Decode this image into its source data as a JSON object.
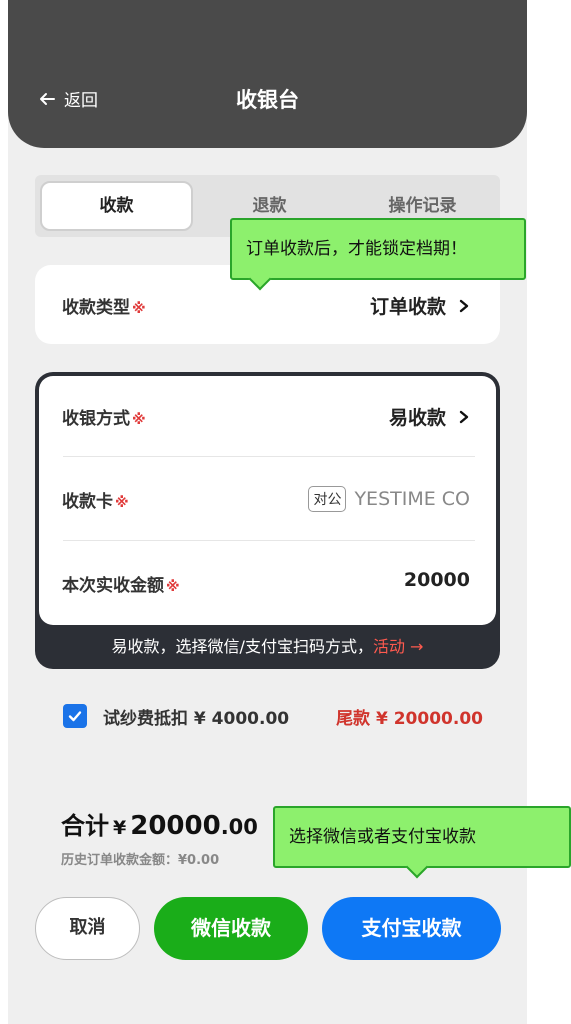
{
  "header": {
    "back_label": "返回",
    "title": "收银台"
  },
  "tabs": [
    {
      "label": "收款"
    },
    {
      "label": "退款"
    },
    {
      "label": "操作记录"
    }
  ],
  "collect_type": {
    "label": "收款类型",
    "required_mark": "※",
    "value": "订单收款"
  },
  "payment": {
    "method_label": "收银方式",
    "method_value": "易收款",
    "card_label": "收款卡",
    "card_tag": "对公",
    "card_value": "YESTIME CO",
    "amount_label": "本次实收金额",
    "amount_value": "20000",
    "required_mark": "※",
    "footer_text": "易收款，选择微信/支付宝扫码方式，",
    "footer_link": "活动 →"
  },
  "deduction": {
    "checked": true,
    "label": "试纱费抵扣 ¥ 4000.00",
    "balance": "尾款 ¥ 20000.00"
  },
  "summary": {
    "total_label": "合计",
    "currency": "¥",
    "total_int": "20000",
    "total_dec": ".00",
    "history": "历史订单收款金额：¥0.00"
  },
  "buttons": {
    "cancel": "取消",
    "wechat": "微信收款",
    "alipay": "支付宝收款"
  },
  "tips": {
    "tip1": "订单收款后，才能锁定档期！",
    "tip2": "选择微信或者支付宝收款"
  },
  "colors": {
    "header": "#4a4a4a",
    "wechat": "#1aad19",
    "alipay": "#0e78f5",
    "required": "#e03a3a",
    "tip": "#8df06d"
  }
}
